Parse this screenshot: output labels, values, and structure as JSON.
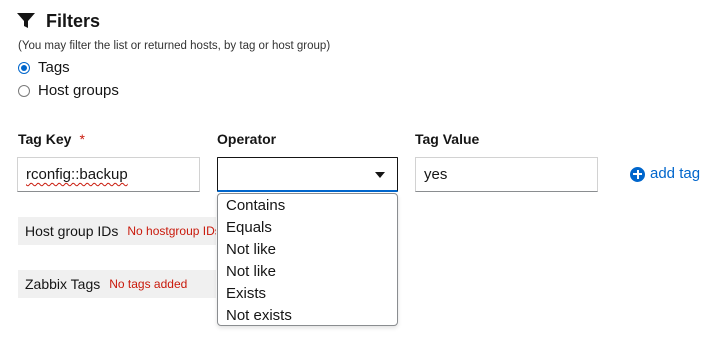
{
  "header": {
    "title": "Filters",
    "hint": "(You may filter the list or returned hosts, by tag or host group)"
  },
  "filter_type": {
    "options": [
      {
        "label": "Tags",
        "checked": true
      },
      {
        "label": "Host groups",
        "checked": false
      }
    ]
  },
  "form": {
    "tag_key_label": "Tag Key",
    "required_mark": "*",
    "tag_key_value": "rconfig::backup",
    "operator_label": "Operator",
    "operator_value": "",
    "tag_value_label": "Tag Value",
    "tag_value_value": "yes",
    "add_tag_label": "add tag"
  },
  "operator_menu": {
    "options": [
      "Contains",
      "Equals",
      "Not like",
      "Not like",
      "Exists",
      "Not exists"
    ]
  },
  "summary": {
    "hostgroup_label": "Host group IDs",
    "hostgroup_empty": "No hostgroup IDs",
    "tags_label": "Zabbix Tags",
    "tags_empty": "No tags added"
  },
  "colors": {
    "accent": "#0066cc",
    "error": "#c9190b",
    "chip_bg": "#f0f0f0"
  },
  "icons": [
    "filter-icon",
    "chevron-down-icon",
    "plus-circle-icon"
  ]
}
